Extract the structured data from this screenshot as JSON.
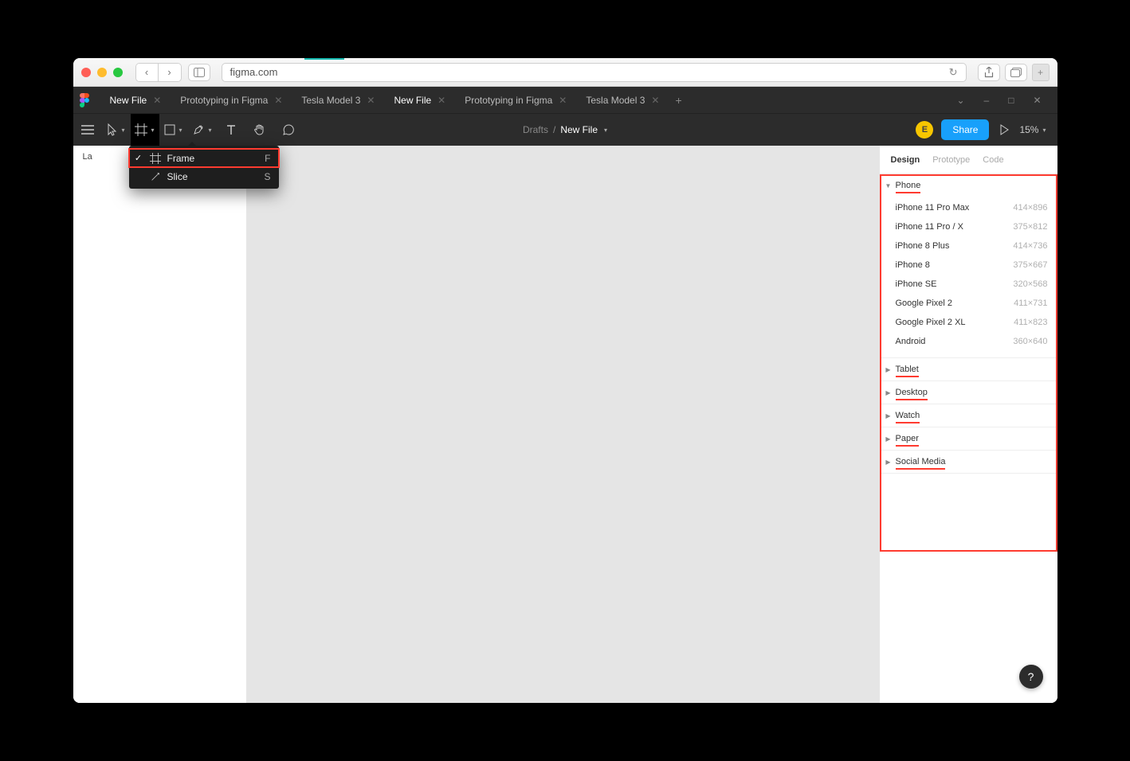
{
  "browser": {
    "url": "figma.com"
  },
  "figma_tabs": [
    {
      "label": "New File",
      "active": true
    },
    {
      "label": "Prototyping in Figma",
      "active": false
    },
    {
      "label": "Tesla Model 3",
      "active": false
    }
  ],
  "breadcrumb": {
    "folder": "Drafts",
    "file": "New File"
  },
  "avatar_initial": "E",
  "share_label": "Share",
  "zoom": "15%",
  "tool_dropdown": [
    {
      "label": "Frame",
      "shortcut": "F",
      "icon": "frame",
      "checked": true,
      "highlight": true
    },
    {
      "label": "Slice",
      "shortcut": "S",
      "icon": "slice",
      "checked": false,
      "highlight": false
    }
  ],
  "left_panel_label": "La",
  "right_tabs": [
    {
      "label": "Design",
      "active": true
    },
    {
      "label": "Prototype",
      "active": false
    },
    {
      "label": "Code",
      "active": false
    }
  ],
  "frame_preset_groups": [
    {
      "name": "Phone",
      "expanded": true,
      "underline": true,
      "items": [
        {
          "name": "iPhone 11 Pro Max",
          "dim": "414×896"
        },
        {
          "name": "iPhone 11 Pro / X",
          "dim": "375×812"
        },
        {
          "name": "iPhone 8 Plus",
          "dim": "414×736"
        },
        {
          "name": "iPhone 8",
          "dim": "375×667"
        },
        {
          "name": "iPhone SE",
          "dim": "320×568"
        },
        {
          "name": "Google Pixel 2",
          "dim": "411×731"
        },
        {
          "name": "Google Pixel 2 XL",
          "dim": "411×823"
        },
        {
          "name": "Android",
          "dim": "360×640"
        }
      ]
    },
    {
      "name": "Tablet",
      "expanded": false,
      "underline": true,
      "items": []
    },
    {
      "name": "Desktop",
      "expanded": false,
      "underline": true,
      "items": []
    },
    {
      "name": "Watch",
      "expanded": false,
      "underline": true,
      "items": []
    },
    {
      "name": "Paper",
      "expanded": false,
      "underline": true,
      "items": []
    },
    {
      "name": "Social Media",
      "expanded": false,
      "underline": true,
      "items": []
    }
  ],
  "help_label": "?"
}
